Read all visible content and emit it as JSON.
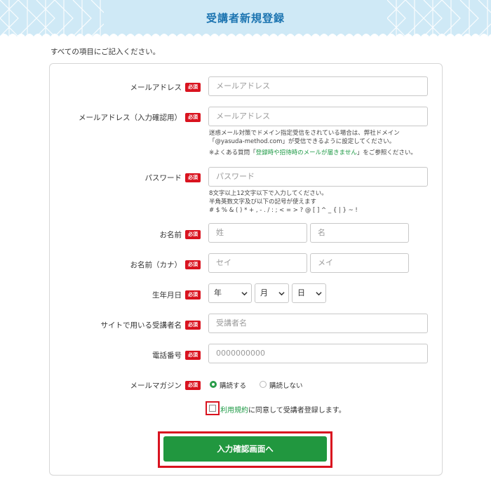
{
  "header": {
    "title": "受講者新規登録"
  },
  "intro": "すべての項目にご記入ください。",
  "required_badge": "必須",
  "fields": {
    "email": {
      "label": "メールアドレス",
      "placeholder": "メールアドレス"
    },
    "email_confirm": {
      "label": "メールアドレス（入力確認用）",
      "placeholder": "メールアドレス"
    },
    "email_note1": "迷惑メール対策でドメイン指定受信をされている場合は、弊社ドメイン",
    "email_note2": "「@yasuda-method.com」が受信できるように設定してください。",
    "email_note3_pre": "※よくある質問「",
    "email_note3_link": "登録時や招待時のメールが届きません",
    "email_note3_post": "」をご参照ください。",
    "password": {
      "label": "パスワード",
      "placeholder": "パスワード"
    },
    "password_note1": "8文字以上12文字以下で入力してください。",
    "password_note2": "半角英数文字及び以下の記号が使えます",
    "password_note3": "# $ % & ( ) * + , - . / : ; < = > ? @ [ ] ^ _ { | } ~ !",
    "name": {
      "label": "お名前",
      "last_placeholder": "姓",
      "first_placeholder": "名"
    },
    "kana": {
      "label": "お名前（カナ）",
      "last_placeholder": "セイ",
      "first_placeholder": "メイ"
    },
    "birthday": {
      "label": "生年月日",
      "year": "年",
      "month": "月",
      "day": "日"
    },
    "display_name": {
      "label": "サイトで用いる受講者名",
      "placeholder": "受講者名"
    },
    "phone": {
      "label": "電話番号",
      "placeholder": "0000000000"
    },
    "magazine": {
      "label": "メールマガジン",
      "option_yes": "購読する",
      "option_no": "購読しない",
      "selected": "購読する"
    }
  },
  "agree": {
    "link": "利用規約",
    "text": "に同意して受講者登録します。"
  },
  "submit_label": "入力確認画面へ",
  "colors": {
    "accent_green": "#21973f",
    "required_red": "#d9131f",
    "header_blue": "#1a73b0"
  }
}
